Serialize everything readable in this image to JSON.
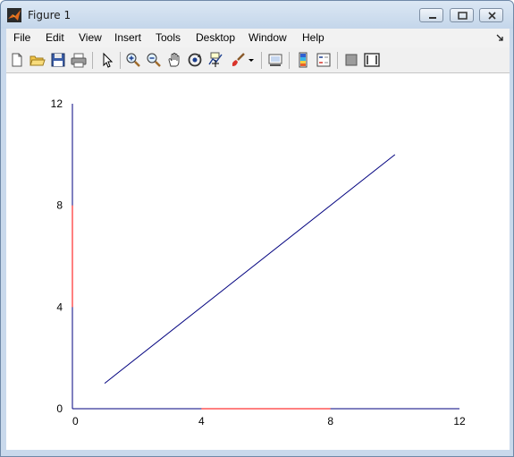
{
  "window": {
    "title": "Figure 1"
  },
  "menu": {
    "items": [
      "File",
      "Edit",
      "View",
      "Insert",
      "Tools",
      "Desktop",
      "Window",
      "Help"
    ]
  },
  "toolbar": {
    "icons": [
      "new-figure-icon",
      "open-file-icon",
      "save-icon",
      "print-icon",
      "pointer-icon",
      "zoom-in-icon",
      "zoom-out-icon",
      "pan-hand-icon",
      "rotate-3d-icon",
      "data-cursor-icon",
      "brush-icon",
      "brush-dropdown-icon",
      "link-plot-icon",
      "colorbar-icon",
      "legend-icon",
      "hide-plot-tools-icon",
      "show-plot-tools-icon"
    ]
  },
  "colors": {
    "line_blue": "#00007f",
    "line_red": "#ff0000",
    "axis": "#00007f"
  },
  "chart_data": {
    "type": "line",
    "xlim": [
      0,
      12
    ],
    "ylim": [
      0,
      12
    ],
    "xticks": [
      "0",
      "4",
      "8",
      "12"
    ],
    "yticks": [
      "0",
      "4",
      "8",
      "12"
    ],
    "title": "",
    "xlabel": "",
    "ylabel": "",
    "grid": false,
    "series": [
      {
        "color": "#00007f",
        "x": [
          1,
          10
        ],
        "y": [
          1,
          10
        ]
      },
      {
        "color": "#ff0000",
        "x": [
          4,
          8
        ],
        "y": [
          0,
          0
        ]
      },
      {
        "color": "#ff0000",
        "x": [
          0,
          0
        ],
        "y": [
          4,
          8
        ]
      }
    ]
  }
}
